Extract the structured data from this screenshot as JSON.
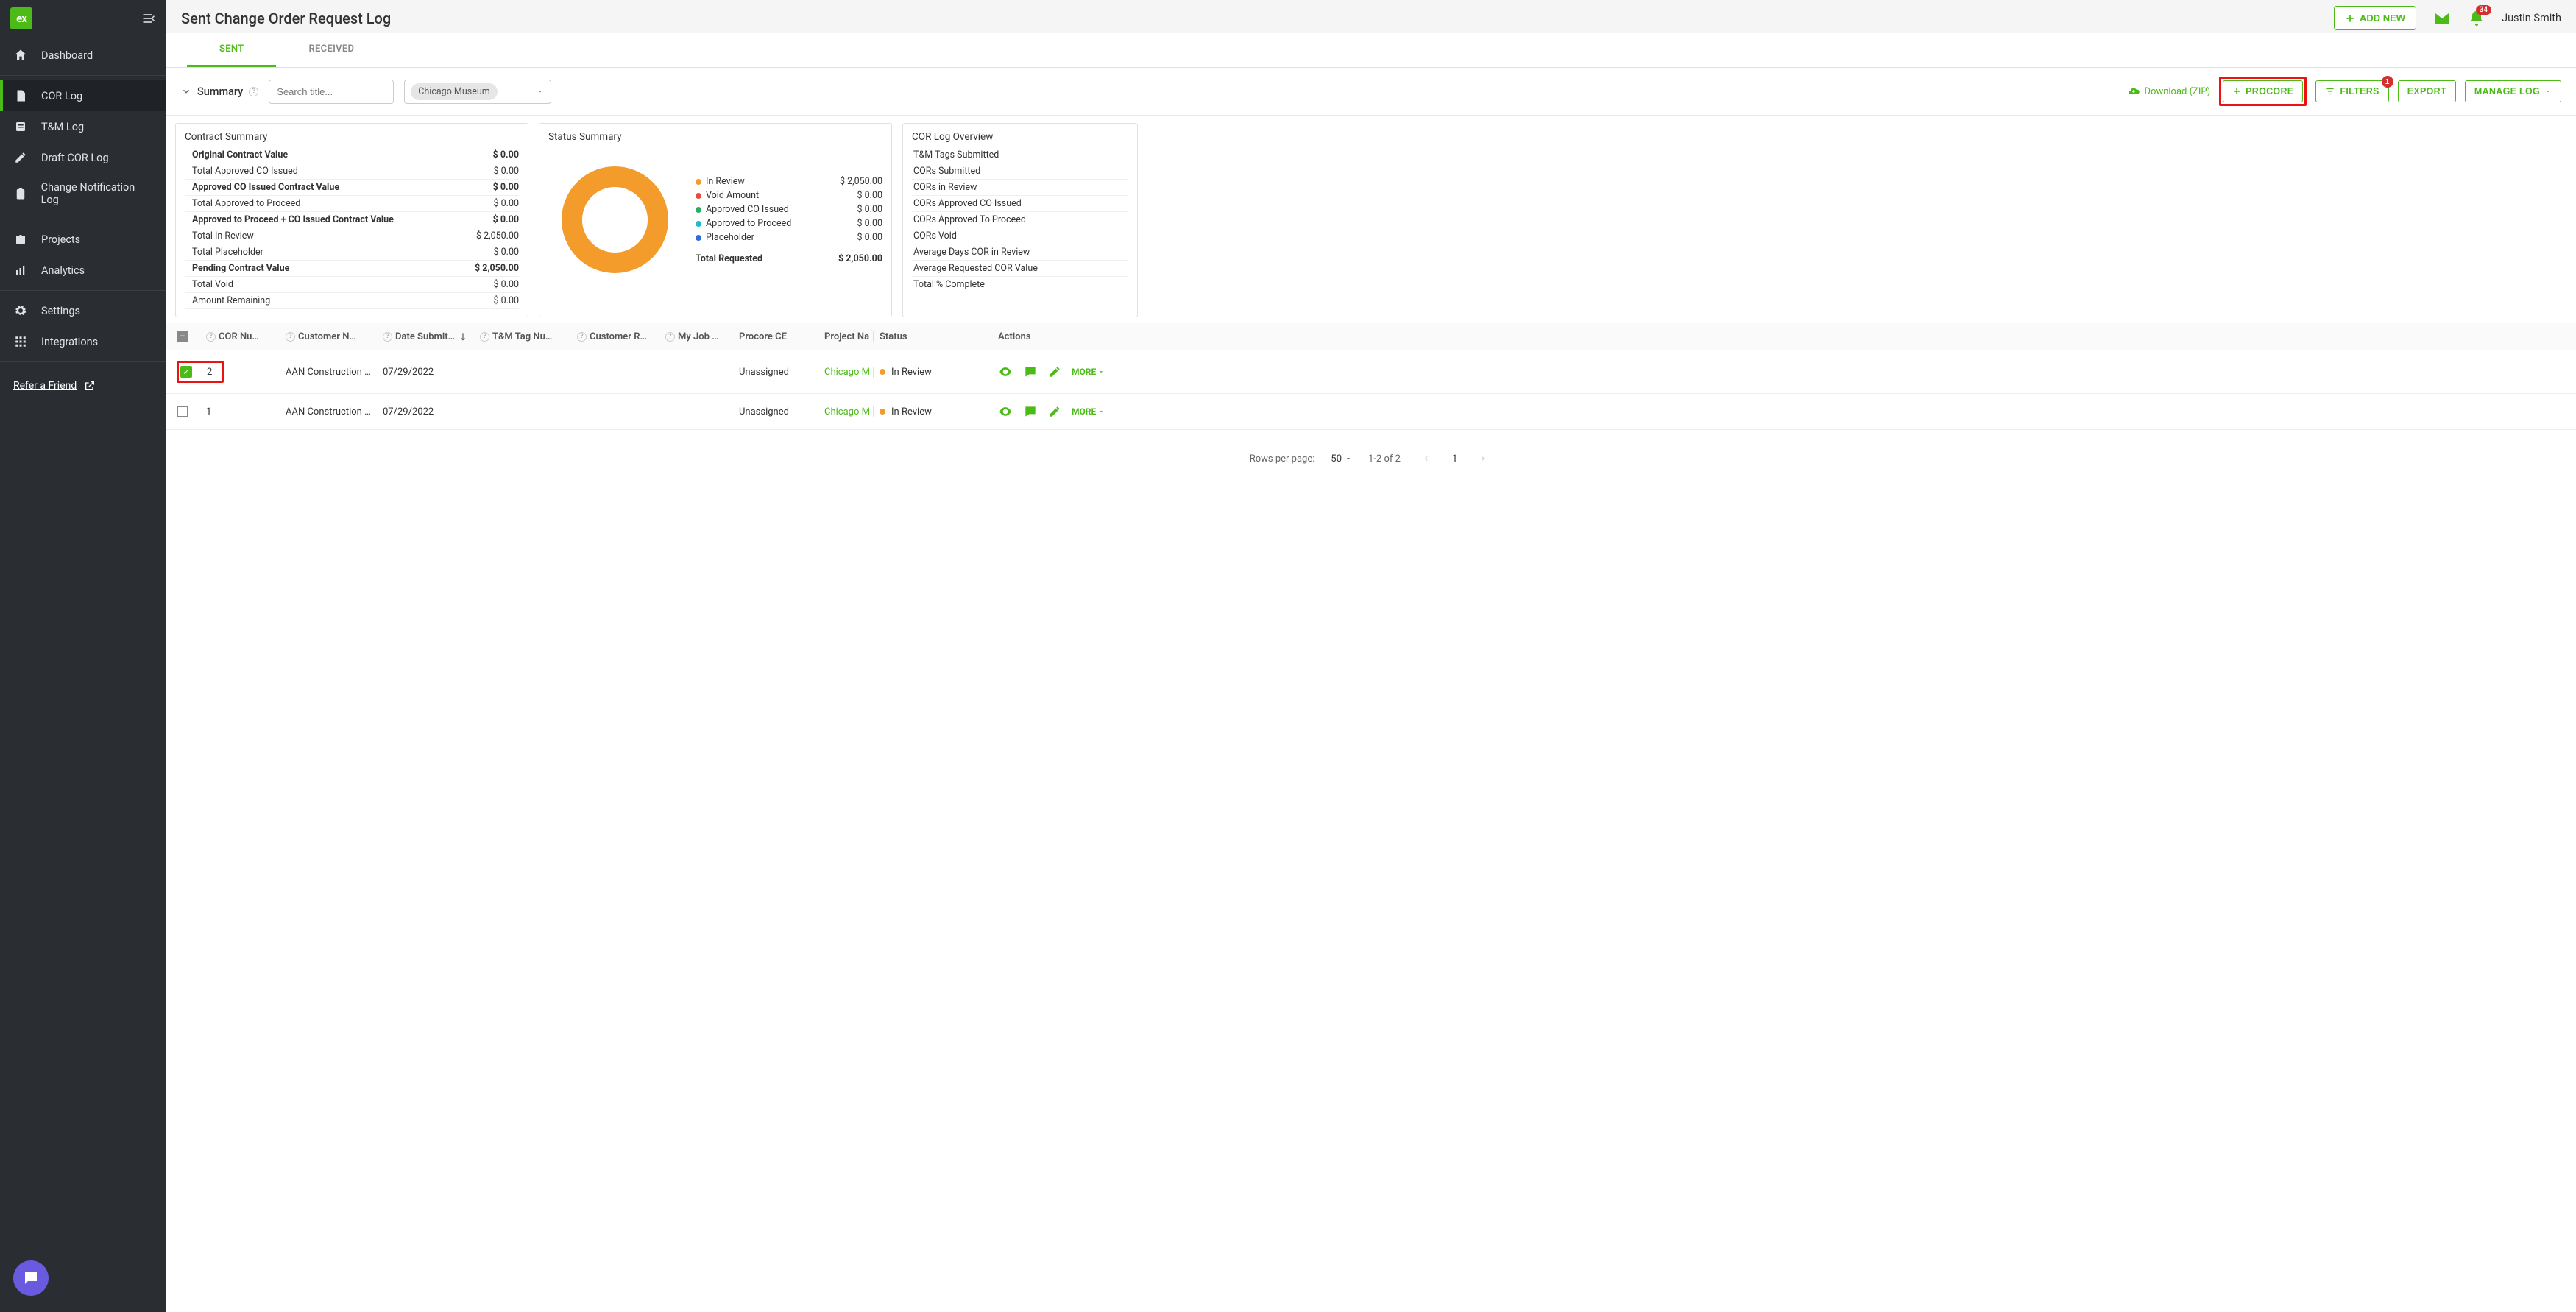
{
  "header": {
    "page_title": "Sent Change Order Request Log",
    "add_new": "ADD NEW",
    "username": "Justin Smith",
    "notification_count": "34"
  },
  "sidebar": {
    "items": [
      {
        "label": "Dashboard",
        "icon": "home"
      },
      {
        "label": "COR Log",
        "icon": "doc",
        "active": true
      },
      {
        "label": "T&M Log",
        "icon": "list"
      },
      {
        "label": "Draft COR Log",
        "icon": "pencil"
      },
      {
        "label": "Change Notification Log",
        "icon": "clip"
      },
      {
        "label": "Projects",
        "icon": "briefcase"
      },
      {
        "label": "Analytics",
        "icon": "bar"
      },
      {
        "label": "Settings",
        "icon": "gear"
      },
      {
        "label": "Integrations",
        "icon": "grid"
      }
    ],
    "refer": "Refer a Friend"
  },
  "tabs": {
    "sent": "SENT",
    "received": "RECEIVED"
  },
  "toolbar": {
    "summary": "Summary",
    "search_placeholder": "Search title...",
    "project_chip": "Chicago Museum",
    "download": "Download (ZIP)",
    "procore": "PROCORE",
    "filters": "FILTERS",
    "filter_count": "1",
    "export": "EXPORT",
    "manage": "MANAGE LOG"
  },
  "contract_summary": {
    "title": "Contract Summary",
    "rows": [
      {
        "label": "Original Contract Value",
        "value": "$ 0.00",
        "bold": true
      },
      {
        "label": "Total Approved CO Issued",
        "value": "$ 0.00"
      },
      {
        "label": "Approved CO Issued Contract Value",
        "value": "$ 0.00",
        "bold": true
      },
      {
        "label": "Total Approved to Proceed",
        "value": "$ 0.00"
      },
      {
        "label": "Approved to Proceed + CO Issued Contract Value",
        "value": "$ 0.00",
        "bold": true
      },
      {
        "label": "Total In Review",
        "value": "$ 2,050.00"
      },
      {
        "label": "Total Placeholder",
        "value": "$ 0.00"
      },
      {
        "label": "Pending Contract Value",
        "value": "$ 2,050.00",
        "bold": true
      },
      {
        "label": "Total Void",
        "value": "$ 0.00"
      },
      {
        "label": "Amount Remaining",
        "value": "$ 0.00"
      }
    ]
  },
  "status_summary": {
    "title": "Status Summary",
    "legend": [
      {
        "label": "In Review",
        "value": "$ 2,050.00",
        "color": "#f39c2b"
      },
      {
        "label": "Void Amount",
        "value": "$ 0.00",
        "color": "#e74c3c"
      },
      {
        "label": "Approved CO Issued",
        "value": "$ 0.00",
        "color": "#27ae60"
      },
      {
        "label": "Approved to Proceed",
        "value": "$ 0.00",
        "color": "#1bbdca"
      },
      {
        "label": "Placeholder",
        "value": "$ 0.00",
        "color": "#2d6cdf"
      }
    ],
    "total_label": "Total Requested",
    "total_value": "$ 2,050.00"
  },
  "chart_data": {
    "type": "pie",
    "title": "Status Summary",
    "series": [
      {
        "name": "Requested",
        "values": [
          2050,
          0,
          0,
          0,
          0
        ]
      }
    ],
    "categories": [
      "In Review",
      "Void Amount",
      "Approved CO Issued",
      "Approved to Proceed",
      "Placeholder"
    ],
    "total": 2050
  },
  "overview": {
    "title": "COR Log Overview",
    "rows": [
      "T&M Tags Submitted",
      "CORs Submitted",
      "CORs in Review",
      "CORs Approved CO Issued",
      "CORs Approved To Proceed",
      "CORs Void",
      "Average Days COR in Review",
      "Average Requested COR Value",
      "Total % Complete"
    ]
  },
  "table": {
    "headers": {
      "cor": "COR Nu…",
      "cust": "Customer N…",
      "date": "Date Submit…",
      "tag": "T&M Tag Nu…",
      "ref": "Customer R…",
      "job": "My Job …",
      "ce": "Procore CE",
      "proj": "Project Na",
      "status": "Status",
      "actions": "Actions"
    },
    "rows": [
      {
        "checked": true,
        "num": "2",
        "customer": "AAN Construction …",
        "date": "07/29/2022",
        "tag": "",
        "ref": "",
        "job": "",
        "ce": "Unassigned",
        "project": "Chicago M",
        "status": "In Review",
        "status_color": "#f39c2b",
        "more": "MORE"
      },
      {
        "checked": false,
        "num": "1",
        "customer": "AAN Construction …",
        "date": "07/29/2022",
        "tag": "",
        "ref": "",
        "job": "",
        "ce": "Unassigned",
        "project": "Chicago M",
        "status": "In Review",
        "status_color": "#f39c2b",
        "more": "MORE"
      }
    ]
  },
  "pagination": {
    "rpp_label": "Rows per page:",
    "rpp": "50",
    "range": "1-2 of 2",
    "page": "1"
  }
}
